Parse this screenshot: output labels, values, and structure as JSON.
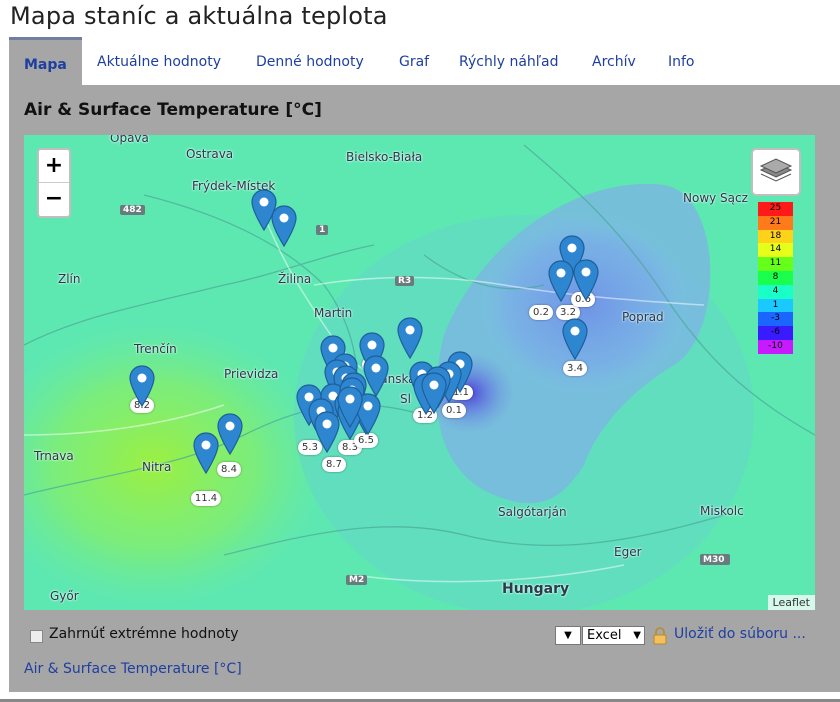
{
  "page": {
    "title": "Mapa staníc a aktuálna teplota"
  },
  "tabs": [
    {
      "label": "Mapa",
      "active": true
    },
    {
      "label": "Aktuálne hodnoty"
    },
    {
      "label": "Denné hodnoty"
    },
    {
      "label": "Graf"
    },
    {
      "label": "Rýchly náhľad"
    },
    {
      "label": "Archív"
    },
    {
      "label": "Info"
    }
  ],
  "panel": {
    "title": "Air & Surface Temperature [°C]"
  },
  "map": {
    "zoom_in": "+",
    "zoom_out": "−",
    "attribution": "Leaflet",
    "legend": [
      {
        "value": "25",
        "color": "#ff1a1a"
      },
      {
        "value": "21",
        "color": "#ff7a1a"
      },
      {
        "value": "18",
        "color": "#ffd21a"
      },
      {
        "value": "14",
        "color": "#e5ff1a"
      },
      {
        "value": "11",
        "color": "#66ff1a"
      },
      {
        "value": "8",
        "color": "#1aff4d"
      },
      {
        "value": "4",
        "color": "#1affc8"
      },
      {
        "value": "1",
        "color": "#1ac9ff"
      },
      {
        "value": "-3",
        "color": "#1a66ff"
      },
      {
        "value": "-6",
        "color": "#3a1aff"
      },
      {
        "value": "-10",
        "color": "#c81aff"
      }
    ],
    "places": [
      "Opava",
      "Ostrava",
      "Bielsko-Biała",
      "Frýdek-Místek",
      "Nowy Sącz",
      "Zlín",
      "Žilina",
      "Martin",
      "Poprad",
      "Trenčín",
      "Prievidza",
      "Banská",
      "Trnava",
      "Nitra",
      "Salgótarján",
      "Miskolc",
      "Eger",
      "Hungary",
      "Győr",
      "Sl"
    ],
    "roads": [
      "482",
      "1",
      "R3",
      "M2",
      "M30"
    ],
    "stations": [
      "0.2",
      "3.2",
      "0.6",
      "4.6",
      "3.4",
      "8.2",
      "1.2",
      "0.1",
      "1.1",
      "5.3",
      "8.3",
      "6.5",
      "8.7",
      "8.4",
      "11.4"
    ]
  },
  "controls": {
    "extremes_label": "Zahrnúť extrémne hodnoty",
    "select_blank": "▼",
    "format_selected": "Excel",
    "save_label": "Uložiť do súboru ..."
  },
  "footer": {
    "link": "Air & Surface Temperature [°C]"
  }
}
